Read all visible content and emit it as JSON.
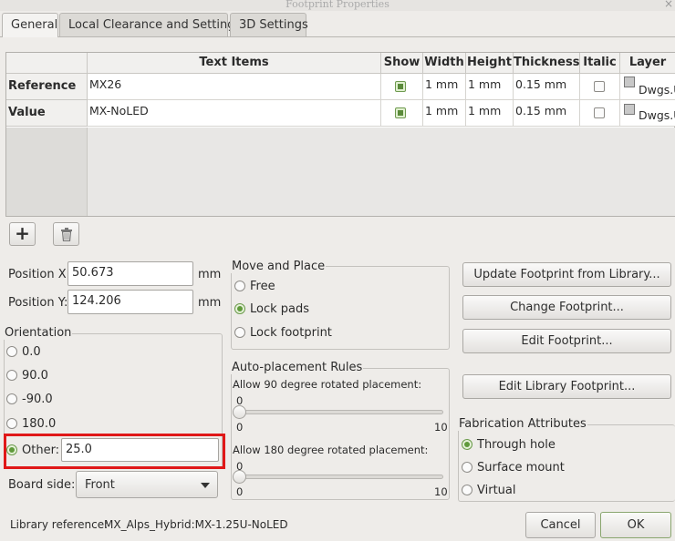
{
  "window": {
    "title": "Footprint Properties",
    "close_glyph": "×"
  },
  "tabs": [
    {
      "label": "General"
    },
    {
      "label": "Local Clearance and Settings"
    },
    {
      "label": "3D Settings"
    }
  ],
  "text_items": {
    "columns": [
      "Text Items",
      "Show",
      "Width",
      "Height",
      "Thickness",
      "Italic",
      "Layer"
    ],
    "rows": [
      {
        "name": "Reference",
        "text": "MX26",
        "show": true,
        "width": "1 mm",
        "height": "1 mm",
        "thickness": "0.15 mm",
        "italic": false,
        "layer": "Dwgs.U"
      },
      {
        "name": "Value",
        "text": "MX-NoLED",
        "show": true,
        "width": "1 mm",
        "height": "1 mm",
        "thickness": "0.15 mm",
        "italic": false,
        "layer": "Dwgs.U"
      }
    ],
    "add_glyph": "+"
  },
  "position": {
    "x_label": "Position X:",
    "x_value": "50.673",
    "y_label": "Position Y:",
    "y_value": "124.206",
    "unit": "mm"
  },
  "orientation": {
    "label": "Orientation",
    "options": [
      "0.0",
      "90.0",
      "-90.0",
      "180.0"
    ],
    "other_label": "Other:",
    "other_value": "25.0",
    "selected": "Other"
  },
  "board_side": {
    "label": "Board side:",
    "value": "Front"
  },
  "move_place": {
    "label": "Move and Place",
    "options": [
      "Free",
      "Lock pads",
      "Lock footprint"
    ],
    "selected": "Lock pads"
  },
  "autoplacement": {
    "label": "Auto-placement Rules",
    "rot90": {
      "label": "Allow 90 degree rotated placement:",
      "value": "0",
      "min": "0",
      "max": "10",
      "level": 0
    },
    "rot180": {
      "label": "Allow 180 degree rotated placement:",
      "value": "0",
      "min": "0",
      "max": "10",
      "level": 0
    }
  },
  "buttons": {
    "update": "Update Footprint from Library...",
    "change": "Change Footprint...",
    "edit": "Edit Footprint...",
    "edit_lib": "Edit Library Footprint..."
  },
  "fabrication": {
    "label": "Fabrication Attributes",
    "options": [
      "Through hole",
      "Surface mount",
      "Virtual"
    ],
    "selected": "Through hole"
  },
  "footer": {
    "lib_ref_label": "Library reference:",
    "lib_ref_value": "MX_Alps_Hybrid:MX-1.25U-NoLED",
    "cancel": "Cancel",
    "ok": "OK"
  }
}
